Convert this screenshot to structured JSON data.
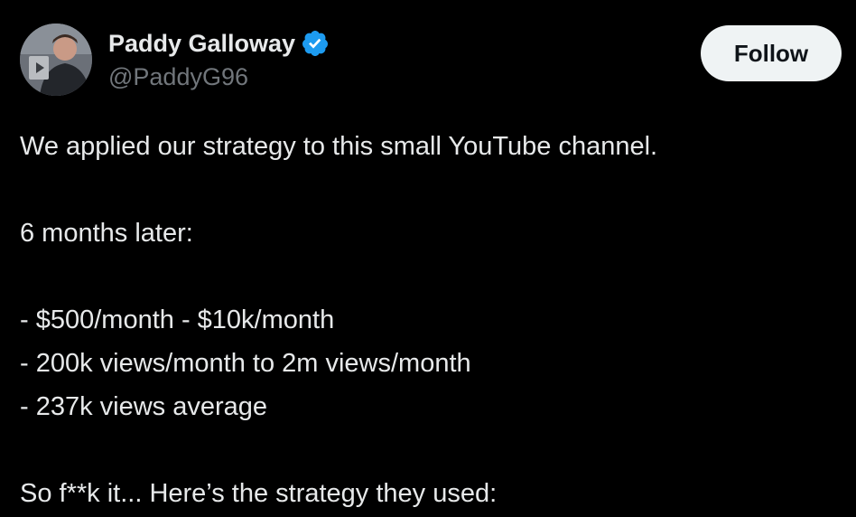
{
  "author": {
    "display_name": "Paddy Galloway",
    "handle": "@PaddyG96",
    "verified": true,
    "verified_color": "#1d9bf0"
  },
  "actions": {
    "follow_label": "Follow"
  },
  "tweet": {
    "lines": [
      "We applied our strategy to this small YouTube channel.",
      "",
      "6 months later:",
      "",
      "- $500/month - $10k/month",
      "- 200k views/month to 2m views/month",
      "- 237k views average",
      "",
      "So f**k it... Here’s the strategy they used:"
    ]
  },
  "colors": {
    "background": "#000000",
    "text": "#e7e9ea",
    "secondary_text": "#71767b",
    "follow_bg": "#eff3f4"
  }
}
